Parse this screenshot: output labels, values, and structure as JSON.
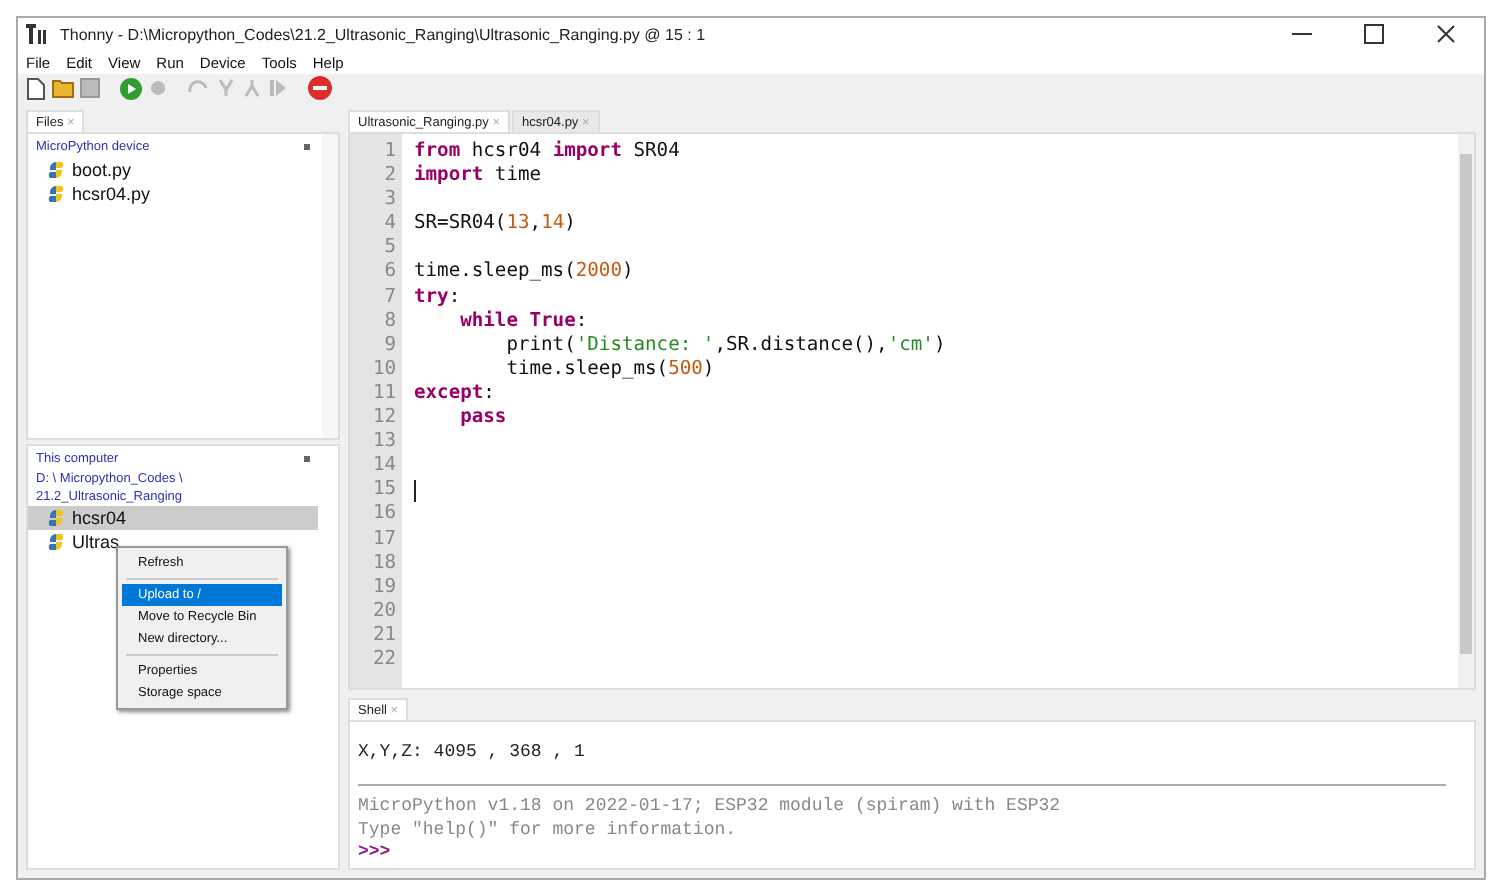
{
  "window": {
    "title": "Thonny  -  D:\\Micropython_Codes\\21.2_Ultrasonic_Ranging\\Ultrasonic_Ranging.py  @  15 : 1"
  },
  "menu": [
    "File",
    "Edit",
    "View",
    "Run",
    "Device",
    "Tools",
    "Help"
  ],
  "files_tab": {
    "label": "Files",
    "close": "×"
  },
  "device_pane": {
    "title": "MicroPython device",
    "files": [
      {
        "name": "boot.py",
        "selected": false
      },
      {
        "name": "hcsr04.py",
        "selected": false
      }
    ]
  },
  "computer_pane": {
    "title": "This computer",
    "path": [
      "D: \\ Micropython_Codes \\",
      "21.2_Ultrasonic_Ranging"
    ],
    "files": [
      {
        "name": "hcsr04",
        "selected": true
      },
      {
        "name": "Ultras",
        "selected": false
      }
    ]
  },
  "context_menu": [
    {
      "kind": "item",
      "label": "Refresh",
      "selected": false
    },
    {
      "kind": "separator"
    },
    {
      "kind": "item",
      "label": "Upload to /",
      "selected": true
    },
    {
      "kind": "item",
      "label": "Move to Recycle Bin",
      "selected": false
    },
    {
      "kind": "item",
      "label": "New directory...",
      "selected": false
    },
    {
      "kind": "separator"
    },
    {
      "kind": "item",
      "label": "Properties",
      "selected": false
    },
    {
      "kind": "item",
      "label": "Storage space",
      "selected": false
    }
  ],
  "editor_tabs": [
    {
      "label": "Ultrasonic_Ranging.py",
      "close": "×",
      "selected": true
    },
    {
      "label": "hcsr04.py",
      "close": "×",
      "selected": false
    }
  ],
  "code": {
    "lines": [
      {
        "number": "1",
        "tokens": [
          {
            "kind": "keyword",
            "text": "from"
          },
          {
            "kind": "plain",
            "text": " hcsr04 "
          },
          {
            "kind": "keyword",
            "text": "import"
          },
          {
            "kind": "plain",
            "text": " SR04"
          }
        ]
      },
      {
        "number": "2",
        "tokens": [
          {
            "kind": "keyword",
            "text": "import"
          },
          {
            "kind": "plain",
            "text": " time"
          }
        ]
      },
      {
        "number": "3"
      },
      {
        "number": "4",
        "tokens": [
          {
            "kind": "plain",
            "text": "SR=SR04("
          },
          {
            "kind": "number",
            "text": "13"
          },
          {
            "kind": "plain",
            "text": ","
          },
          {
            "kind": "number",
            "text": "14"
          },
          {
            "kind": "plain",
            "text": ")"
          }
        ]
      },
      {
        "number": "5"
      },
      {
        "number": "6",
        "tokens": [
          {
            "kind": "plain",
            "text": "time.sleep_ms("
          },
          {
            "kind": "number",
            "text": "2000"
          },
          {
            "kind": "plain",
            "text": ")"
          }
        ]
      },
      {
        "number": "7",
        "tokens": [
          {
            "kind": "keyword",
            "text": "try"
          },
          {
            "kind": "plain",
            "text": ":"
          }
        ]
      },
      {
        "number": "8",
        "tokens": [
          {
            "kind": "keyword",
            "text": "    while"
          },
          {
            "kind": "keyword",
            "text": " True"
          },
          {
            "kind": "plain",
            "text": ":"
          }
        ]
      },
      {
        "number": "9",
        "tokens": [
          {
            "kind": "plain",
            "text": "        print("
          },
          {
            "kind": "string",
            "text": "'Distance: '"
          },
          {
            "kind": "plain",
            "text": ",SR.distance(),"
          },
          {
            "kind": "string",
            "text": "'cm'"
          },
          {
            "kind": "plain",
            "text": ")"
          }
        ]
      },
      {
        "number": "10",
        "tokens": [
          {
            "kind": "plain",
            "text": "        time.sleep_ms("
          },
          {
            "kind": "number",
            "text": "500"
          },
          {
            "kind": "plain",
            "text": ")"
          }
        ]
      },
      {
        "number": "11",
        "tokens": [
          {
            "kind": "keyword",
            "text": "except"
          },
          {
            "kind": "plain",
            "text": ":"
          }
        ]
      },
      {
        "number": "12",
        "tokens": [
          {
            "kind": "keyword",
            "text": "    pass"
          }
        ]
      },
      {
        "number": "13"
      },
      {
        "number": "14"
      },
      {
        "number": "15",
        "cursor": true
      },
      {
        "number": "16"
      },
      {
        "number": "17"
      },
      {
        "number": "18"
      },
      {
        "number": "19"
      },
      {
        "number": "20"
      },
      {
        "number": "21"
      },
      {
        "number": "22"
      }
    ]
  },
  "shell": {
    "tab": {
      "label": "Shell",
      "close": "×"
    },
    "output": [
      "X,Y,Z: 4095 , 368 , 1"
    ],
    "banner": [
      "MicroPython v1.18 on 2022-01-17; ESP32 module (spiram) with ESP32",
      "Type \"help()\" for more information."
    ],
    "prompt": ">>>"
  }
}
